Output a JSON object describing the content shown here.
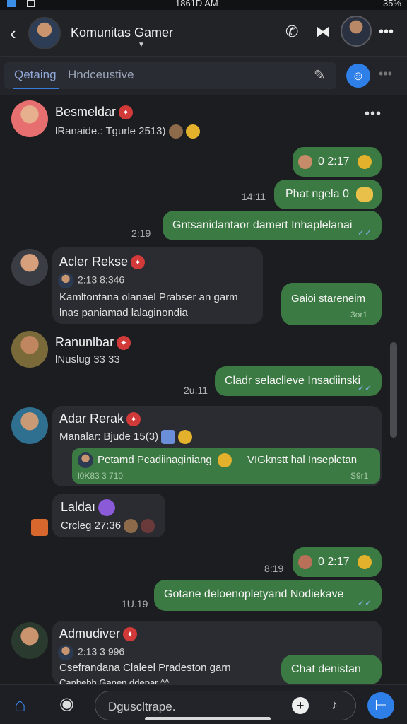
{
  "status": {
    "time": "1861D AM",
    "battery": "35%"
  },
  "header": {
    "title": "Komunitas Gamer",
    "caret": "▼"
  },
  "tabs": [
    {
      "label": "Qetaing"
    },
    {
      "label": "Hndceustive"
    }
  ],
  "messages": {
    "m1": {
      "name": "Besmeldar",
      "sub": "lRanaide.: Tgurle 2513)"
    },
    "o1": {
      "time": "0 2:17"
    },
    "o2": {
      "stamp": "14:11",
      "text": "Phat ngela 0"
    },
    "o3": {
      "stamp": "2:19",
      "text": "Gntsanidantaor damert Inhaplelanai"
    },
    "m2": {
      "name": "Acler Rekse",
      "sub": "2:13 8:346",
      "line1": "Kamltontana olanael Prabser an garm",
      "line2": "lnas paniamad lalaginondia"
    },
    "o4": {
      "text": "Gaioi stareneim",
      "meta": "3or1"
    },
    "m3": {
      "name": "Ranunlbar",
      "sub": "lNuslug 33 33"
    },
    "o5": {
      "stamp": "2u.11",
      "text": "Cladr selaclleve Insadiinski"
    },
    "m4": {
      "name": "Adar Rerak",
      "sub": "Manalar: Bjude 15(3)",
      "quote": "Petamd Pcadiinaginiang",
      "quote2": "VIGknstt hal Insepletan",
      "qmeta": "l0K83 3 710",
      "qmeta2": "S9r1"
    },
    "m5": {
      "name": "Laldaı",
      "sub": "Crcleg 27:36"
    },
    "o6": {
      "stamp": "8:19",
      "time": "0 2:17"
    },
    "o7": {
      "stamp": "1U.19",
      "text": "Gotane deloenopletyand Nodiekave"
    },
    "m6": {
      "name": "Admudiver",
      "sub": "2:13 3 996",
      "line1": "Csefrandana Claleel Pradeston garn",
      "line2": "Canbebh Ganen ddepar ^^"
    },
    "o8": {
      "text": "Chat denistan"
    }
  },
  "input": {
    "placeholder": "Dguscltrape."
  },
  "colors": {
    "accent": "#2f7fe8",
    "bubble_out": "#3c7a43",
    "bubble_in": "#2b2c31",
    "badge": "#d23a3a"
  }
}
